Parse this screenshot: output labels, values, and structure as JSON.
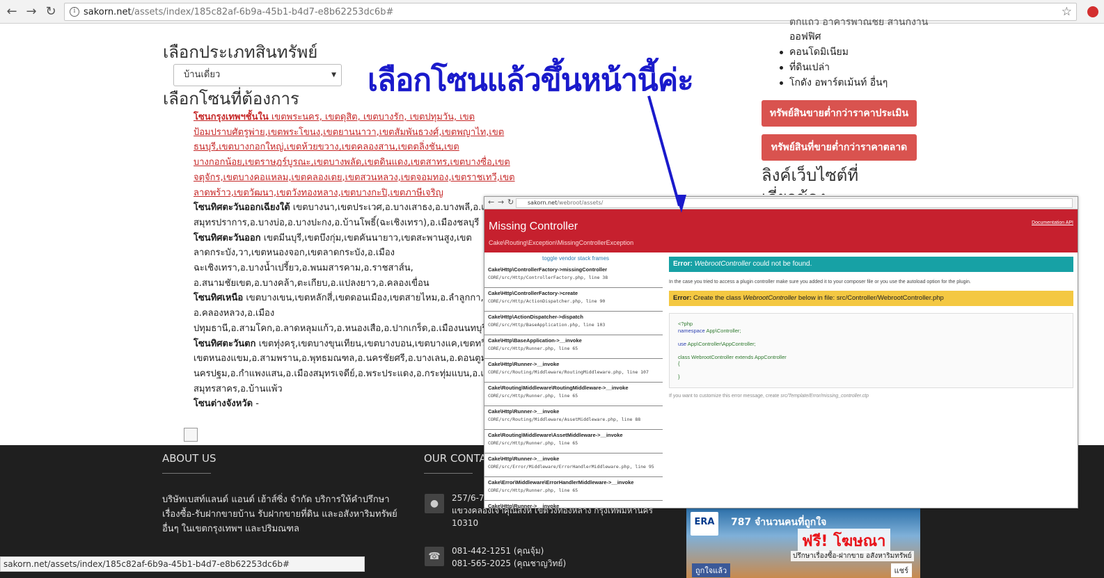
{
  "browser": {
    "url_host": "sakorn.net",
    "url_path": "/assets/index/185c82af-6b9a-45b1-b4d7-e8b62253dc6b#"
  },
  "filter": {
    "category_heading": "เลือกประเภทสินทรัพย์",
    "category_selected": "บ้านเดี่ยว",
    "zone_heading": "เลือกโซนที่ต้องการ"
  },
  "zones": [
    {
      "title": "โซนกรุงเทพฯชั้นใน",
      "text": " เขตพระนคร, เขตดุสิต, เขตบางรัก, เขตปทุมวัน, เขตป้อมปราบศัตรูพ่าย,เขตพระโขนง,เขตยานนาวา,เขตสัมพันธวงศ์,เขตพญาไท,เขตธนบุรี,เขตบางกอกใหญ่,เขตห้วยขวาง,เขตคลองสาน,เขตตลิ่งชัน,เขตบางกอกน้อย,เขตราษฎร์บูรณะ,เขตบางพลัด,เขตดินแดง,เขตสาทร,เขตบางซื่อ,เขตจตุจักร,เขตบางคอแหลม,เขตคลองเตย,เขตสวนหลวง,เขตจอมทอง,เขตราชเทวี,เขตลาดพร้าว,เขตวัฒนา,เขตวังทองหลาง,เขตบางกะปิ,เขตภาษีเจริญ"
    },
    {
      "title": "โซนทิศตะวันออกเฉียงใต้",
      "text": " เขตบางนา,เขตประเวศ,อ.บางเสาธง,อ.บางพลี,อ.เมืองสมุทรปราการ,อ.บางบ่อ,อ.บางปะกง,อ.บ้านโพธิ์(ฉะเชิงเทรา),อ.เมืองชลบุรี"
    },
    {
      "title": "โซนทิศตะวันออก",
      "text": " เขตมีนบุรี,เขตบึงกุ่ม,เขตคันนายาว,เขตสะพานสูง,เขตลาดกระบัง,วา,เขตหนองจอก,เขตลาดกระบัง,อ.เมืองฉะเชิงเทรา,อ.บางน้ำเปรี้ยว,อ.พนมสารคาม,อ.ราชสาส์น, อ.สนามชัยเขต,อ.บางคล้า,ตะเกียบ,อ.แปลงยาว,อ.คลองเขื่อน"
    },
    {
      "title": "โซนทิศเหนือ",
      "text": " เขตบางเขน,เขตหลักสี่,เขตดอนเมือง,เขตสายไหม,อ.ลำลูกกา,อ.ธัญบุรี, อ.คลองหลวง,อ.เมืองปทุมธานี,อ.สามโคก,อ.ลาดหลุมแก้ว,อ.หนองเสือ,อ.ปากเกร็ด,อ.เมืองนนทบุรี,อ.บางกรวย,อ.บางบัวทอง,อ.บางใหญ่,อ.ไทรน้อย"
    },
    {
      "title": "โซนทิศตะวันตก",
      "text": " เขตทุ่งครุ,เขตบางขุนเทียน,เขตบางบอน,เขตบางแค,เขตทวีวัฒนา, เขตหนองแขม,อ.สามพราน,อ.พุทธมณฑล,อ.นครชัยศรี,อ.บางเลน,อ.ดอนตูม,อ.เมืองนครปฐม,อ.กำแพงแสน,อ.เมืองสมุทรเจดีย์,อ.พระประแดง,อ.กระทุ่มแบน,อ.เมืองสมุทรสาคร,อ.บ้านแพ้ว"
    },
    {
      "title": "โซนต่างจังหวัด",
      "text": " -"
    }
  ],
  "annotation": {
    "text": "เลือกโซนแล้วขึ้นหน้านี้ค่ะ"
  },
  "sidebar": {
    "partial_top": "ตึกแถว อาคารพาณิชย์ สำนักงาน",
    "items": [
      "ออฟฟิศ",
      "คอนโดมิเนียม",
      "ที่ดินเปล่า",
      "โกดัง อพาร์ตเม้นท์ อื่นๆ"
    ],
    "btn_below_appraisal": "ทรัพย์สินขายต่ำกว่าราคาประเมิน",
    "btn_below_market": "ทรัพย์สินที่ขายต่ำกว่าราคาตลาด",
    "links_heading_1": "ลิงค์เว็บไซต์ที่",
    "links_heading_2": "เกี่ยวข้อง"
  },
  "footer": {
    "about_heading": "ABOUT US",
    "about_text": "บริษัทเบสท์แลนด์ แอนด์ เฮ้าส์ซิ่ง จำกัด บริการให้คำปรึกษาเรื่องซื้อ-รับฝากขายบ้าน รับฝากขายที่ดิน และอสังหาริมทรัพย์อื่นๆ ในเขตกรุงเทพฯ และปริมณฑล",
    "contact_heading": "OUR CONTACT",
    "address_1": "257/6-7 ซ.ลาดพร้าว 101 ถนนลาดพร้าว",
    "address_2": "แขวงคลองเจ้าคุณสิงห์ เขตวังทองหลาง กรุงเทพมหานคร",
    "address_3": "10310",
    "phone_1": "081-442-1251 (คุณจุ้ม)",
    "phone_2": "081-565-2025 (คุณชาญวิทย์)",
    "ad_brand": "ERA",
    "ad_line1": "787 จำนวนคนที่ถูกใจ",
    "ad_free": "ฟรี! โฆษณา",
    "ad_line2": "ปรึกษาเรื่องซื้อ-ฝากขาย อสังหาริมทรัพย์",
    "ad_like": "ถูกใจแล้ว",
    "ad_share": "แชร์"
  },
  "status_bar": "sakorn.net/assets/index/185c82af-6b9a-45b1-b4d7-e8b62253dc6b#",
  "error_page": {
    "url_host": "sakorn.net",
    "url_path": "/webroot/assets/",
    "title": "Missing Controller",
    "exception": "Cake\\Routing\\Exception\\MissingControllerException",
    "links": "Documentation  API",
    "toggle": "toggle vendor stack frames",
    "stack": [
      {
        "fn": "Cake\\Http\\ControllerFactory->missingController",
        "file": "CORE/src/Http/ControllerFactory.php, line 38"
      },
      {
        "fn": "Cake\\Http\\ControllerFactory->create",
        "file": "CORE/src/Http/ActionDispatcher.php, line 90"
      },
      {
        "fn": "Cake\\Http\\ActionDispatcher->dispatch",
        "file": "CORE/src/Http/BaseApplication.php, line 103"
      },
      {
        "fn": "Cake\\Http\\BaseApplication->__invoke",
        "file": "CORE/src/Http/Runner.php, line 65"
      },
      {
        "fn": "Cake\\Http\\Runner->__invoke",
        "file": "CORE/src/Routing/Middleware/RoutingMiddleware.php, line 107"
      },
      {
        "fn": "Cake\\Routing\\Middleware\\RoutingMiddleware->__invoke",
        "file": "CORE/src/Http/Runner.php, line 65"
      },
      {
        "fn": "Cake\\Http\\Runner->__invoke",
        "file": "CORE/src/Routing/Middleware/AssetMiddleware.php, line 88"
      },
      {
        "fn": "Cake\\Routing\\Middleware\\AssetMiddleware->__invoke",
        "file": "CORE/src/Http/Runner.php, line 65"
      },
      {
        "fn": "Cake\\Http\\Runner->__invoke",
        "file": "CORE/src/Error/Middleware/ErrorHandlerMiddleware.php, line 95"
      },
      {
        "fn": "Cake\\Error\\Middleware\\ErrorHandlerMiddleware->__invoke",
        "file": "CORE/src/Http/Runner.php, line 65"
      },
      {
        "fn": "Cake\\Http\\Runner->__invoke",
        "file": ""
      }
    ],
    "error_label": "Error:",
    "error1_class": "WebrootController",
    "error1_rest": " could not be found.",
    "info": "In the case you tried to access a plugin controller make sure you added it to your composer file or you use the autoload option for the plugin.",
    "error2_pre": "Create the class ",
    "error2_class": "WebrootController",
    "error2_post": " below in file: src/Controller/WebrootController.php",
    "code_lines": [
      "<?php",
      "namespace App\\Controller;",
      "",
      "use App\\Controller\\AppController;",
      "",
      "class WebrootController extends AppController",
      "{",
      "",
      "}"
    ],
    "footer_pre": "If you want to customize this error message, create ",
    "footer_path": "src/Template/Error/missing_controller.ctp"
  }
}
